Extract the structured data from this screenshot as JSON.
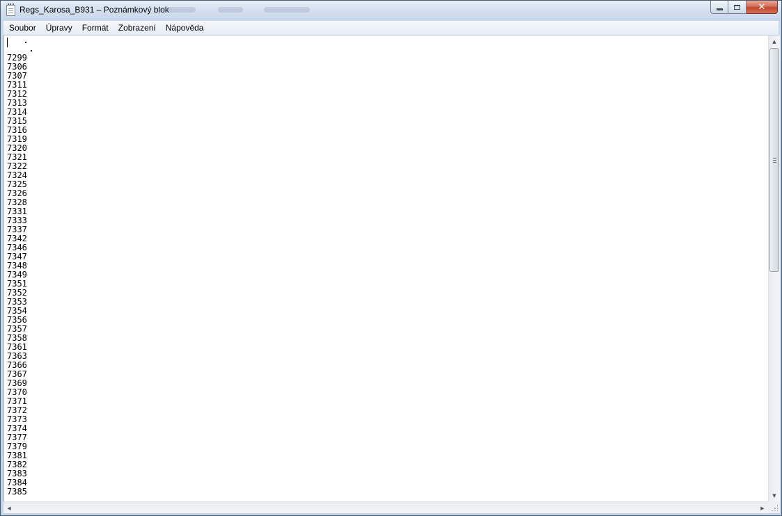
{
  "window": {
    "title": "Regs_Karosa_B931 – Poznámkový blok",
    "icon": "notepad-icon"
  },
  "menu": {
    "items": [
      {
        "label": "Soubor"
      },
      {
        "label": "Úpravy"
      },
      {
        "label": "Formát"
      },
      {
        "label": "Zobrazení"
      },
      {
        "label": "Nápověda"
      }
    ]
  },
  "document": {
    "lines": [
      "7299",
      "7306",
      "7307",
      "7311",
      "7312",
      "7313",
      "7314",
      "7315",
      "7316",
      "7319",
      "7320",
      "7321",
      "7322",
      "7324",
      "7325",
      "7326",
      "7328",
      "7331",
      "7333",
      "7337",
      "7342",
      "7346",
      "7347",
      "7348",
      "7349",
      "7351",
      "7352",
      "7353",
      "7354",
      "7356",
      "7357",
      "7358",
      "7361",
      "7363",
      "7366",
      "7367",
      "7369",
      "7370",
      "7371",
      "7372",
      "7373",
      "7374",
      "7377",
      "7379",
      "7381",
      "7382",
      "7383",
      "7384",
      "7385"
    ]
  },
  "scrollbar": {
    "vertical_up": "▲",
    "vertical_down": "▼",
    "horizontal_left": "◀",
    "horizontal_right": "▶"
  },
  "colors": {
    "close_button": "#c2452b",
    "editor_background": "#ffffff",
    "frame": "#c9d9ec"
  }
}
